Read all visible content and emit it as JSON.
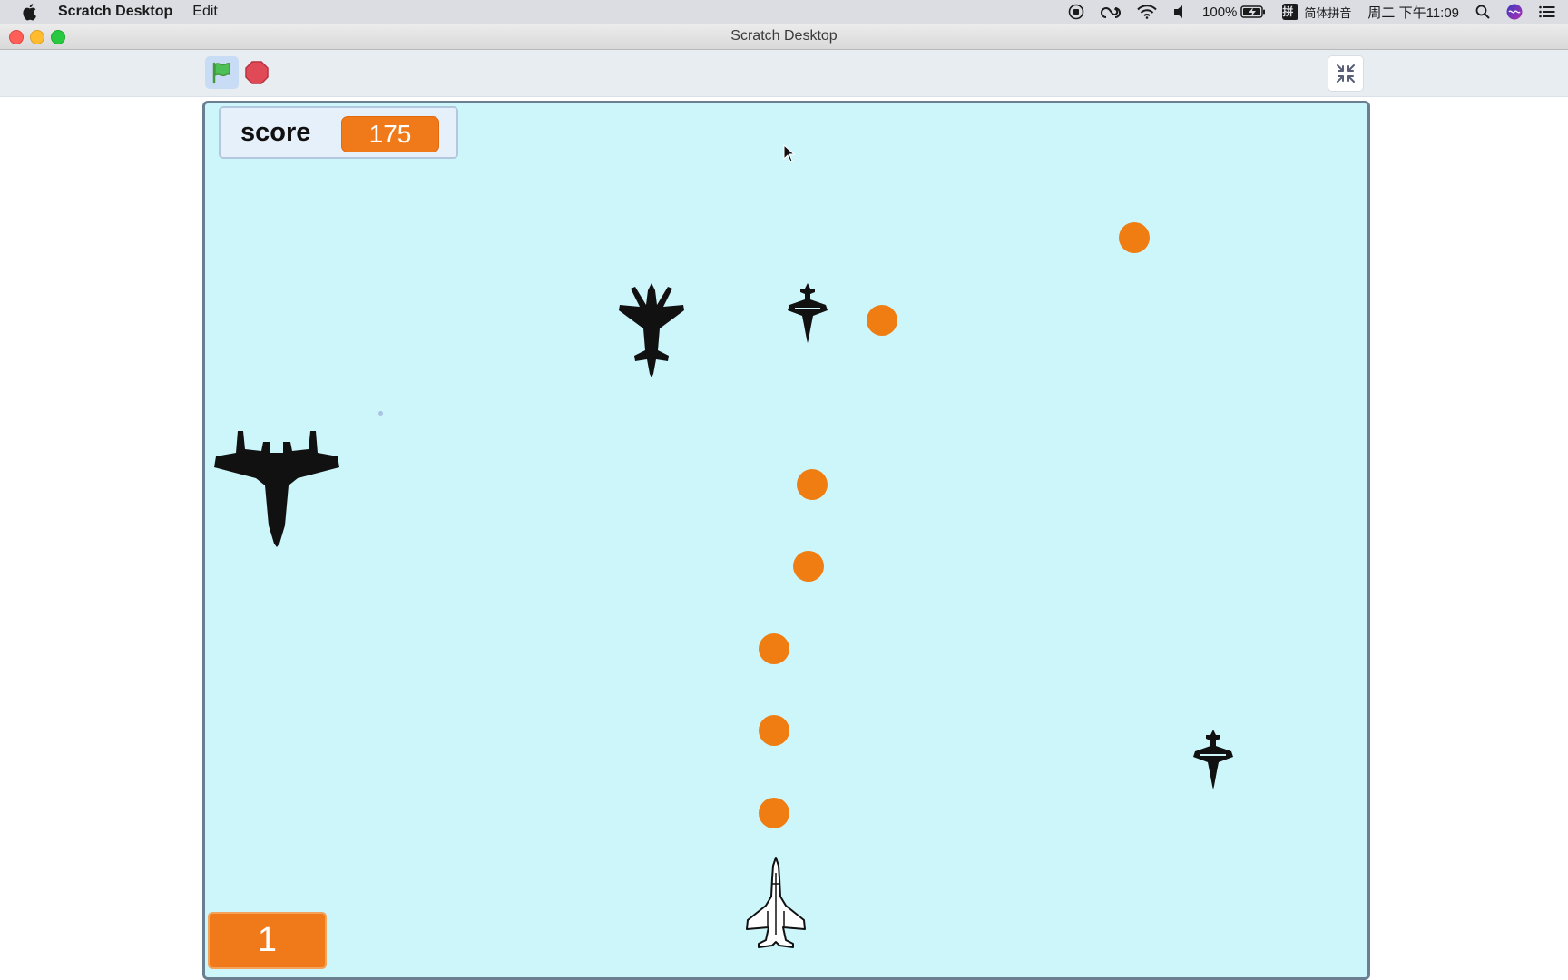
{
  "menubar": {
    "app_name": "Scratch Desktop",
    "items": [
      "Edit"
    ],
    "battery": "100%",
    "input_method": "简体拼音",
    "ime_glyph": "拼",
    "clock": "周二 下午11:09"
  },
  "window": {
    "title": "Scratch Desktop"
  },
  "stage": {
    "monitor_score": {
      "label": "score",
      "value": "175"
    },
    "monitor_large": {
      "value": "1"
    }
  },
  "colors": {
    "stage_background": "#cdf6fb",
    "monitor_orange": "#f07a1a",
    "bullet_orange": "#ef7d12",
    "green_flag": "#4cbf56",
    "stop_red": "#e04a57"
  }
}
